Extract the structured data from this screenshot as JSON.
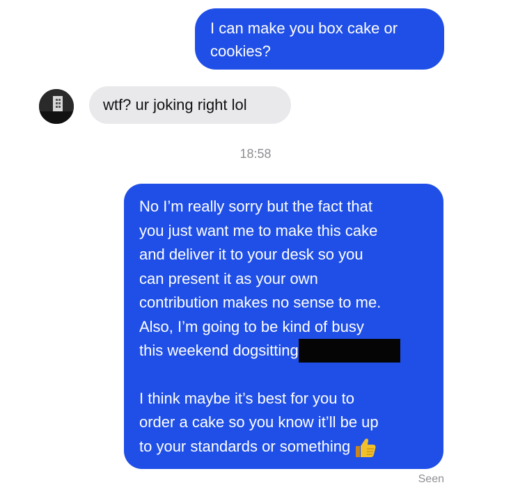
{
  "conversation": {
    "message_1": {
      "lines": [
        "I can make you box cake or",
        "cookies?"
      ]
    },
    "message_2": {
      "text": "wtf? ur joking right lol"
    },
    "timestamp": "18:58",
    "message_3": {
      "lines": [
        "No I’m really sorry but the fact that",
        "you just want me to make this cake",
        "and deliver it to your desk so you",
        "can present it as your own",
        "contribution makes no sense to me.",
        "Also, I’m going to be kind of busy",
        "this weekend dogsitting",
        "",
        "I think maybe it’s best for you to",
        "order a cake so you know it’ll be up",
        "to your standards or something"
      ],
      "emoji": "thumbs-up-icon"
    },
    "status": "Seen"
  },
  "colors": {
    "outgoing_bubble": "#1f4fe6",
    "incoming_bubble": "#e9e9ec",
    "meta_text": "#8e8e93"
  }
}
